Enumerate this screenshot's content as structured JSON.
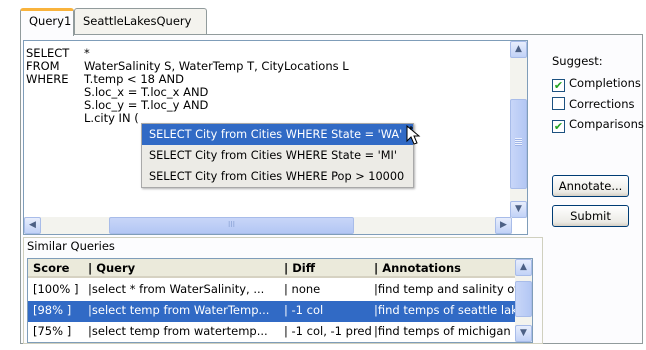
{
  "tabs": [
    "Query1",
    "SeattleLakesQuery"
  ],
  "editor": {
    "lines": [
      {
        "kw": "SELECT",
        "text": "*"
      },
      {
        "kw": "FROM",
        "text": "WaterSalinity S, WaterTemp T, CityLocations L"
      },
      {
        "kw": "WHERE",
        "text": "T.temp < 18 AND"
      },
      {
        "kw": "",
        "text": "S.loc_x = T.loc_x AND"
      },
      {
        "kw": "",
        "text": "S.loc_y = T.loc_y AND"
      },
      {
        "kw": "",
        "text": "L.city IN ("
      }
    ],
    "autocomplete": [
      "SELECT City from Cities WHERE State = 'WA'",
      "SELECT City from Cities WHERE State = 'MI'",
      "SELECT City from Cities WHERE Pop > 10000"
    ],
    "selected_suggestion": 0,
    "hscroll_grip": "III"
  },
  "suggest": {
    "title": "Suggest:",
    "options": [
      {
        "label": "Completions",
        "checked": true
      },
      {
        "label": "Corrections",
        "checked": false
      },
      {
        "label": "Comparisons",
        "checked": true
      }
    ]
  },
  "buttons": {
    "annotate": "Annotate...",
    "submit": "Submit"
  },
  "similar": {
    "title": "Similar Queries",
    "columns": [
      "Score",
      "| Query",
      "| Diff",
      "| Annotations"
    ],
    "rows": [
      {
        "score": "[100% ]",
        "query": "|select * from WaterSalinity, ...",
        "diff": "| none",
        "ann": "|find temp and salinity of"
      },
      {
        "score": "[98%  ]",
        "query": "|select temp from WaterTemp...",
        "diff": "| -1 col",
        "ann": "|find temps of seattle lak"
      },
      {
        "score": "[75%  ]",
        "query": "|select temp from watertemp...",
        "diff": "| -1 col, -1 pred",
        "ann": "|find temps of michigan l"
      }
    ],
    "selected_row": 1
  },
  "colors": {
    "selection": "#316ac5",
    "tab_accent": "#f9b33c"
  }
}
